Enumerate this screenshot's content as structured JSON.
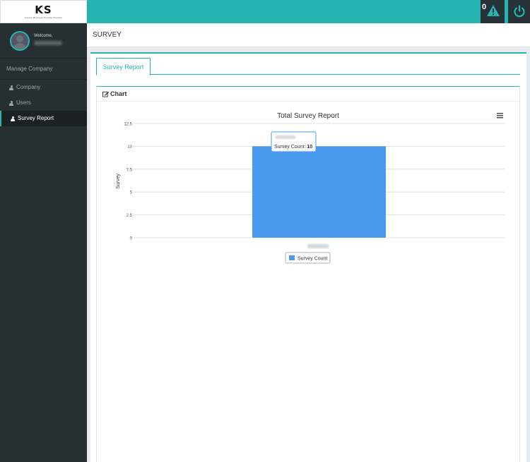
{
  "header": {
    "logo_text": "KS",
    "logo_sub": "Custom Business Solution Provider",
    "alert_count": "0",
    "alert_icon": "warning-icon",
    "power_icon": "power-icon"
  },
  "sidebar": {
    "welcome": "Welcome,",
    "section": "Manage Company",
    "items": [
      {
        "label": "Company",
        "icon": "user-icon",
        "active": false
      },
      {
        "label": "Users",
        "icon": "user-icon",
        "active": false
      },
      {
        "label": "Survey Report",
        "icon": "user-icon",
        "active": true
      }
    ]
  },
  "page": {
    "title": "SURVEY",
    "tab": "Survey Report",
    "panel_title": "Chart"
  },
  "colors": {
    "accent": "#26b4b0",
    "sidebar": "#263033",
    "bar": "#4a9af0"
  },
  "chart_data": {
    "type": "bar",
    "title": "Total Survey Report",
    "ylabel": "Survey",
    "xlabel": "",
    "categories": [
      ""
    ],
    "series": [
      {
        "name": "Survey Count",
        "values": [
          10
        ]
      }
    ],
    "ylim": [
      0,
      12.5
    ],
    "yticks": [
      "0",
      "2.5",
      "5",
      "7.5",
      "10",
      "12.5"
    ],
    "tooltip": {
      "label": "Survey Count:",
      "value": "10"
    },
    "legend": "bottom-center",
    "grid": true
  }
}
